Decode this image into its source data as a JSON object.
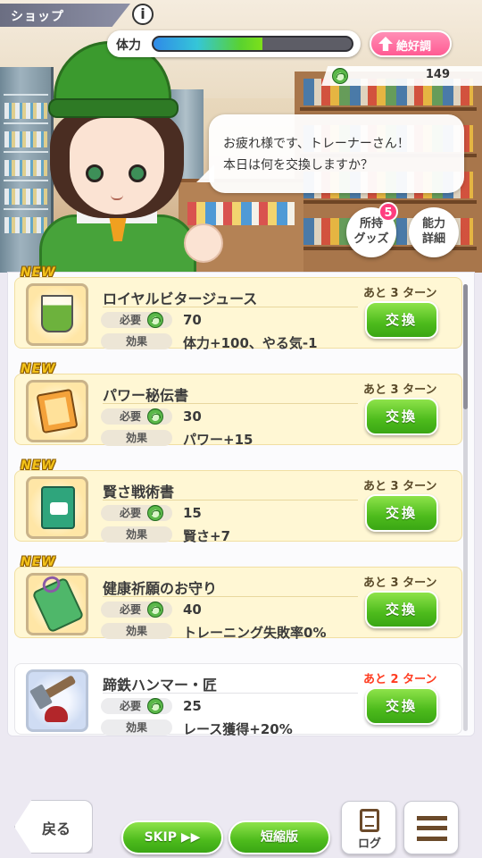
{
  "header": {
    "shop_label": "ショップ",
    "info_label": "i",
    "stamina_label": "体力",
    "stamina_fraction": 0.55,
    "mood_label": "絶好調",
    "coin_count": "149"
  },
  "dialog": {
    "line1": "お疲れ様です、トレーナーさん！",
    "line2": "本日は何を交換しますか？"
  },
  "side_buttons": {
    "owned_label_1": "所持",
    "owned_label_2": "グッズ",
    "owned_badge": "5",
    "ability_label_1": "能力",
    "ability_label_2": "詳細"
  },
  "list": {
    "required_label": "必要",
    "effect_label": "効果",
    "exchange_label": "交換",
    "new_label": "NEW",
    "items": [
      {
        "name": "ロイヤルビタージュース",
        "cost": "70",
        "effect": "体力+100、やる気-1",
        "turns": "あと 3 ターン",
        "is_new": true,
        "icon": "juice-glass-icon"
      },
      {
        "name": "パワー秘伝書",
        "cost": "30",
        "effect": "パワー+15",
        "turns": "あと 3 ターン",
        "is_new": true,
        "icon": "scroll-book-icon"
      },
      {
        "name": "賢さ戦術書",
        "cost": "15",
        "effect": "賢さ+7",
        "turns": "あと 3 ターン",
        "is_new": true,
        "icon": "tactics-book-icon"
      },
      {
        "name": "健康祈願のお守り",
        "cost": "40",
        "effect": "トレーニング失敗率0%",
        "turns": "あと 3 ターン",
        "is_new": true,
        "icon": "charm-amulet-icon"
      },
      {
        "name": "蹄鉄ハンマー・匠",
        "cost": "25",
        "effect": "レース獲得+20%",
        "turns": "あと 2 ターン",
        "is_new": false,
        "icon": "hammer-icon"
      }
    ]
  },
  "footer": {
    "back_label": "戻る",
    "skip_label": "SKIP ▶▶",
    "short_label": "短縮版",
    "log_label": "ログ",
    "menu_icon": "hamburger-menu-icon"
  },
  "colors": {
    "accent_green": "#4dbb1c",
    "mood_pink": "#ff5b93",
    "turns_red": "#ff3b1f",
    "new_yellow": "#f3c21a"
  }
}
